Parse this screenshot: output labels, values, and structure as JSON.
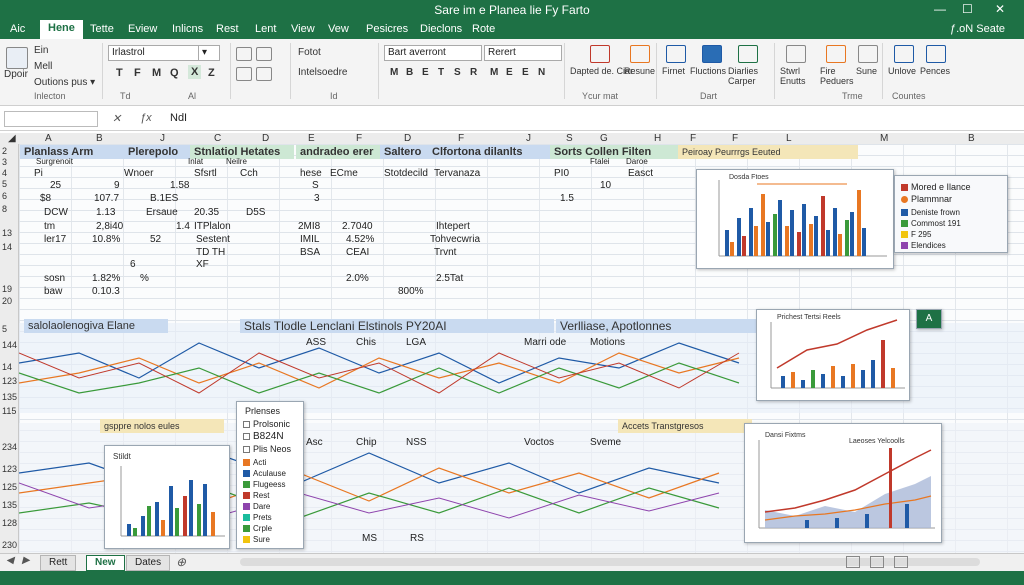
{
  "app": {
    "title": "Sare im e Planea lie Fy Farto",
    "window_controls": {
      "min": "—",
      "max": "☐",
      "close": "✕"
    }
  },
  "tabs": [
    {
      "label": "Aic"
    },
    {
      "label": "Hene",
      "active": true
    },
    {
      "label": "Tette"
    },
    {
      "label": "Eview"
    },
    {
      "label": "Inlicns"
    },
    {
      "label": "Rest"
    },
    {
      "label": "Lent"
    },
    {
      "label": "View"
    },
    {
      "label": "Vew"
    },
    {
      "label": "Pesicres"
    },
    {
      "label": "Dieclons"
    },
    {
      "label": "Rote"
    }
  ],
  "account": "ƒ.oN Seate",
  "ribbon": {
    "clipboard": {
      "paste": "Dpoir",
      "cut": "Ein",
      "copy": "Mell",
      "format": "Outions pus ▾",
      "group": "Inlecton"
    },
    "font": {
      "name": "Irlastrol",
      "size": "▾",
      "buttons": [
        "T",
        "F",
        "M",
        "Q",
        "X",
        "Z"
      ],
      "group": "Td"
    },
    "align": {
      "group": "Al"
    },
    "number": {
      "item1": "Fotot",
      "item2": "Intelsoedre",
      "group": "Id"
    },
    "styles": {
      "dropdown": "Bart averront",
      "buttons": [
        "M",
        "B",
        "E",
        "T",
        "S",
        "R"
      ]
    },
    "cells": {
      "dropdown": "Rerert",
      "buttons": [
        "M",
        "E",
        "E",
        "N"
      ]
    },
    "editing": {
      "items": [
        "Dapted de. Ciar",
        "Resune",
        "Firnet",
        "Fluctions",
        "Diarlies Carper",
        "Stwrl Enutts",
        "Fire Peduers",
        "Sune",
        "Unlove",
        "Pences"
      ],
      "groups": [
        "Ycur mat",
        "Dart",
        "Trme",
        "Countes"
      ]
    }
  },
  "formula_bar": {
    "name_box": "",
    "fx": "ƒx",
    "value": "NdI"
  },
  "columns": [
    "A",
    "B",
    "J",
    "C",
    "D",
    "E",
    "F",
    "D",
    "F",
    "J",
    "S",
    "G",
    "H",
    "F",
    "F",
    "L",
    "M",
    "B"
  ],
  "rows": [
    "2",
    "3",
    "4",
    "5",
    "6",
    "8",
    "13",
    "14",
    "19",
    "20",
    "5",
    "144",
    "14",
    "123",
    "135",
    "115",
    "234",
    "123",
    "125",
    "135",
    "128",
    "230"
  ],
  "bands": {
    "top": [
      "Planlass Arm",
      "Plerepolo",
      "Stnlatiol Hetates",
      "andradeo erer",
      "Saltero",
      "Clfortona dilanlts",
      "Sorts Collen Filten",
      "Peiroay Peurrrgs Eeuted"
    ],
    "mid": "salolaolenogiva Elane",
    "mid2": "Stals Tlodle Lenclani Elstinols PY20AI",
    "mid3": "Verlliase, Apotlonnes",
    "low": "gsppre nolos eules",
    "low2": "Accets Transtgresos"
  },
  "cells": {
    "r1": [
      "Surgrenoit",
      "Inlat",
      "Neilre",
      "Ftalei",
      "Daroe"
    ],
    "r2": [
      "Pi",
      "Wnoer",
      "Sfsrtl",
      "Cch",
      "hese",
      "ECme",
      "Stotdecild",
      "Tervanaza",
      "PI0",
      "Easct"
    ],
    "r3": [
      "25",
      "9",
      "1.58",
      "S",
      "10"
    ],
    "r4": [
      "$8",
      "107.7",
      "B.1ES",
      "3",
      "1.5"
    ],
    "r5": [
      "DCW",
      "1.13",
      "Ersaue",
      "20.35",
      "D5S"
    ],
    "r6": [
      "tm",
      "2,8i40",
      "1.4",
      "ITPlalon",
      "2MI8",
      "2.7040",
      "Ihtepert"
    ],
    "r7": [
      "ler17",
      "10.8%",
      "52",
      "Sestent",
      "IMIL",
      "4.52%",
      "Tohvecwria"
    ],
    "r8": [
      "sosn",
      "1.82%",
      "6",
      "TD TH",
      "BSA",
      "CEAI",
      "Trvnt"
    ],
    "r9": [
      "baw",
      "0.10.3",
      "%",
      "XF",
      "2.0%",
      "2.5Tat",
      "800%"
    ],
    "mid_row": [
      "ASS",
      "Chis",
      "LGA",
      "Marri ode",
      "Motions"
    ],
    "low_row": [
      "Asc",
      "Chip",
      "NSS",
      "Voctos",
      "Sveme"
    ],
    "bottom": [
      "MS",
      "RS"
    ]
  },
  "charts": {
    "chart1_title": "Dosda Ftoes",
    "chart1_legend": [
      "Mored e Ilance",
      "Plammnar",
      "Deniste frown",
      "Commost 191",
      "F 295",
      "Elendices"
    ],
    "chart2_title": "Prichest Tertsi Reels",
    "chart3_title": "Dansi Fixtms",
    "chart4_title": "Laeoses Yelcoolls",
    "popup_title": "Prlenses",
    "popup_items": [
      "Prolsonic",
      "B824N",
      "Plis Neos",
      "Acti",
      "Aculause",
      "Flugeess",
      "Rest",
      "Dare",
      "Prets",
      "Crple",
      "Sure"
    ],
    "left_chart_title": "Stildt",
    "mini_badge": "A"
  },
  "sheet_tabs": [
    {
      "label": "Rett"
    },
    {
      "label": "New",
      "active": true
    },
    {
      "label": "Dates"
    }
  ],
  "colors": {
    "accent": "#1e7145",
    "bar_blue": "#1f5aa6",
    "bar_orange": "#e87722",
    "bar_red": "#c0392b",
    "bar_green": "#3a9a3a"
  }
}
